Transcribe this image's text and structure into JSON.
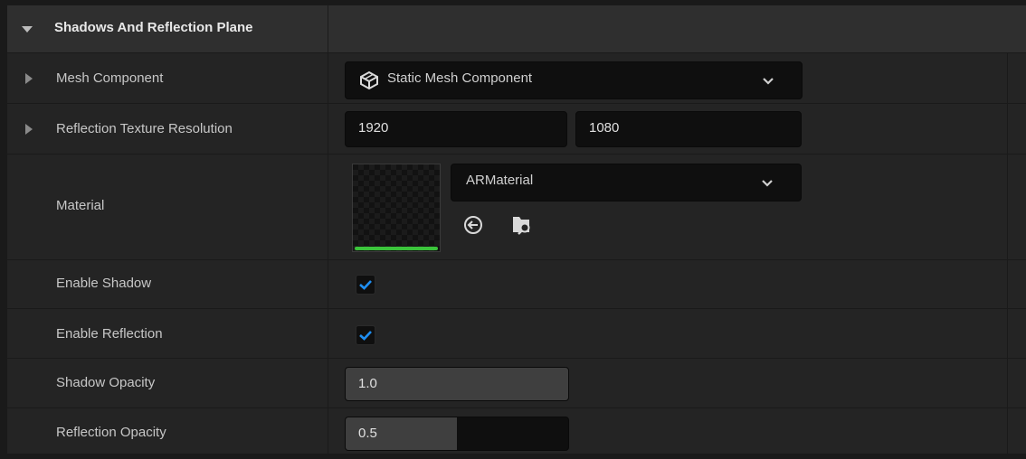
{
  "section": {
    "title": "Shadows And Reflection Plane"
  },
  "rows": {
    "mesh": {
      "label": "Mesh Component",
      "value": "Static Mesh Component",
      "icon": "static-mesh-icon"
    },
    "reflection_res": {
      "label": "Reflection Texture Resolution",
      "x": "1920",
      "y": "1080"
    },
    "material": {
      "label": "Material",
      "value": "ARMaterial",
      "accent": "#3bc43b"
    },
    "enable_shadow": {
      "label": "Enable Shadow",
      "checked": true
    },
    "enable_reflection": {
      "label": "Enable Reflection",
      "checked": true
    },
    "shadow_opacity": {
      "label": "Shadow Opacity",
      "value": "1.0",
      "fraction": 1.0
    },
    "reflection_opacity": {
      "label": "Reflection Opacity",
      "value": "0.5",
      "fraction": 0.5
    }
  },
  "colors": {
    "checkbox_check": "#1f8ef1",
    "slider_fill": "#3f3f3f"
  }
}
